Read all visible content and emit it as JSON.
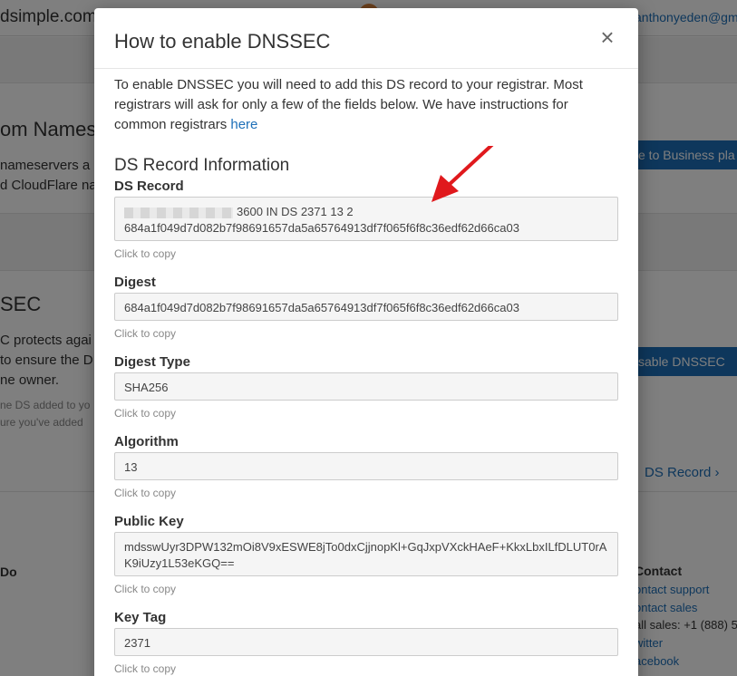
{
  "background": {
    "brand": "dsimple.com",
    "user": "anthonyeden@gma",
    "section1_title": "om Names",
    "section1_line1": "nameservers a",
    "section1_line2": "d CloudFlare na",
    "upgrade_button": "e to Business pla",
    "section2_title": "SEC",
    "section2_line1": "C protects agai",
    "section2_line2": "to ensure the D",
    "section2_line3": "ne owner.",
    "section2_small1": "ne DS added to yo",
    "section2_small2": "ure you've added",
    "enable_button": "sable DNSSEC",
    "ds_record_link": "DS Record ›",
    "footer_left_head": "Do",
    "footer_contact_head": "Contact",
    "footer_links": [
      "ontact support",
      "ontact sales",
      "all sales: +1 (888) 5",
      "witter",
      "acebook"
    ]
  },
  "modal": {
    "title": "How to enable DNSSEC",
    "close_glyph": "×",
    "intro_text": "To enable DNSSEC you will need to add this DS record to your registrar. Most registrars will ask for only a few of the fields below. We have instructions for common registrars ",
    "intro_link": "here",
    "section_title": "DS Record Information",
    "copy_hint": "Click to copy",
    "fields": {
      "ds_record": {
        "label": "DS Record",
        "value_suffix": "3600 IN DS 2371 13 2",
        "value_line2": "684a1f049d7d082b7f98691657da5a65764913df7f065f6f8c36edf62d66ca03"
      },
      "digest": {
        "label": "Digest",
        "value": "684a1f049d7d082b7f98691657da5a65764913df7f065f6f8c36edf62d66ca03"
      },
      "digest_type": {
        "label": "Digest Type",
        "value": "SHA256"
      },
      "algorithm": {
        "label": "Algorithm",
        "value": "13"
      },
      "public_key": {
        "label": "Public Key",
        "value": "mdsswUyr3DPW132mOi8V9xESWE8jTo0dxCjjnopKl+GqJxpVXckHAeF+KkxLbxILfDLUT0rAK9iUzy1L53eKGQ=="
      },
      "key_tag": {
        "label": "Key Tag",
        "value": "2371"
      }
    }
  },
  "colors": {
    "link": "#1d6fb8",
    "annotation_arrow": "#e0191d",
    "overlay": "rgba(0,0,0,0.5)"
  }
}
